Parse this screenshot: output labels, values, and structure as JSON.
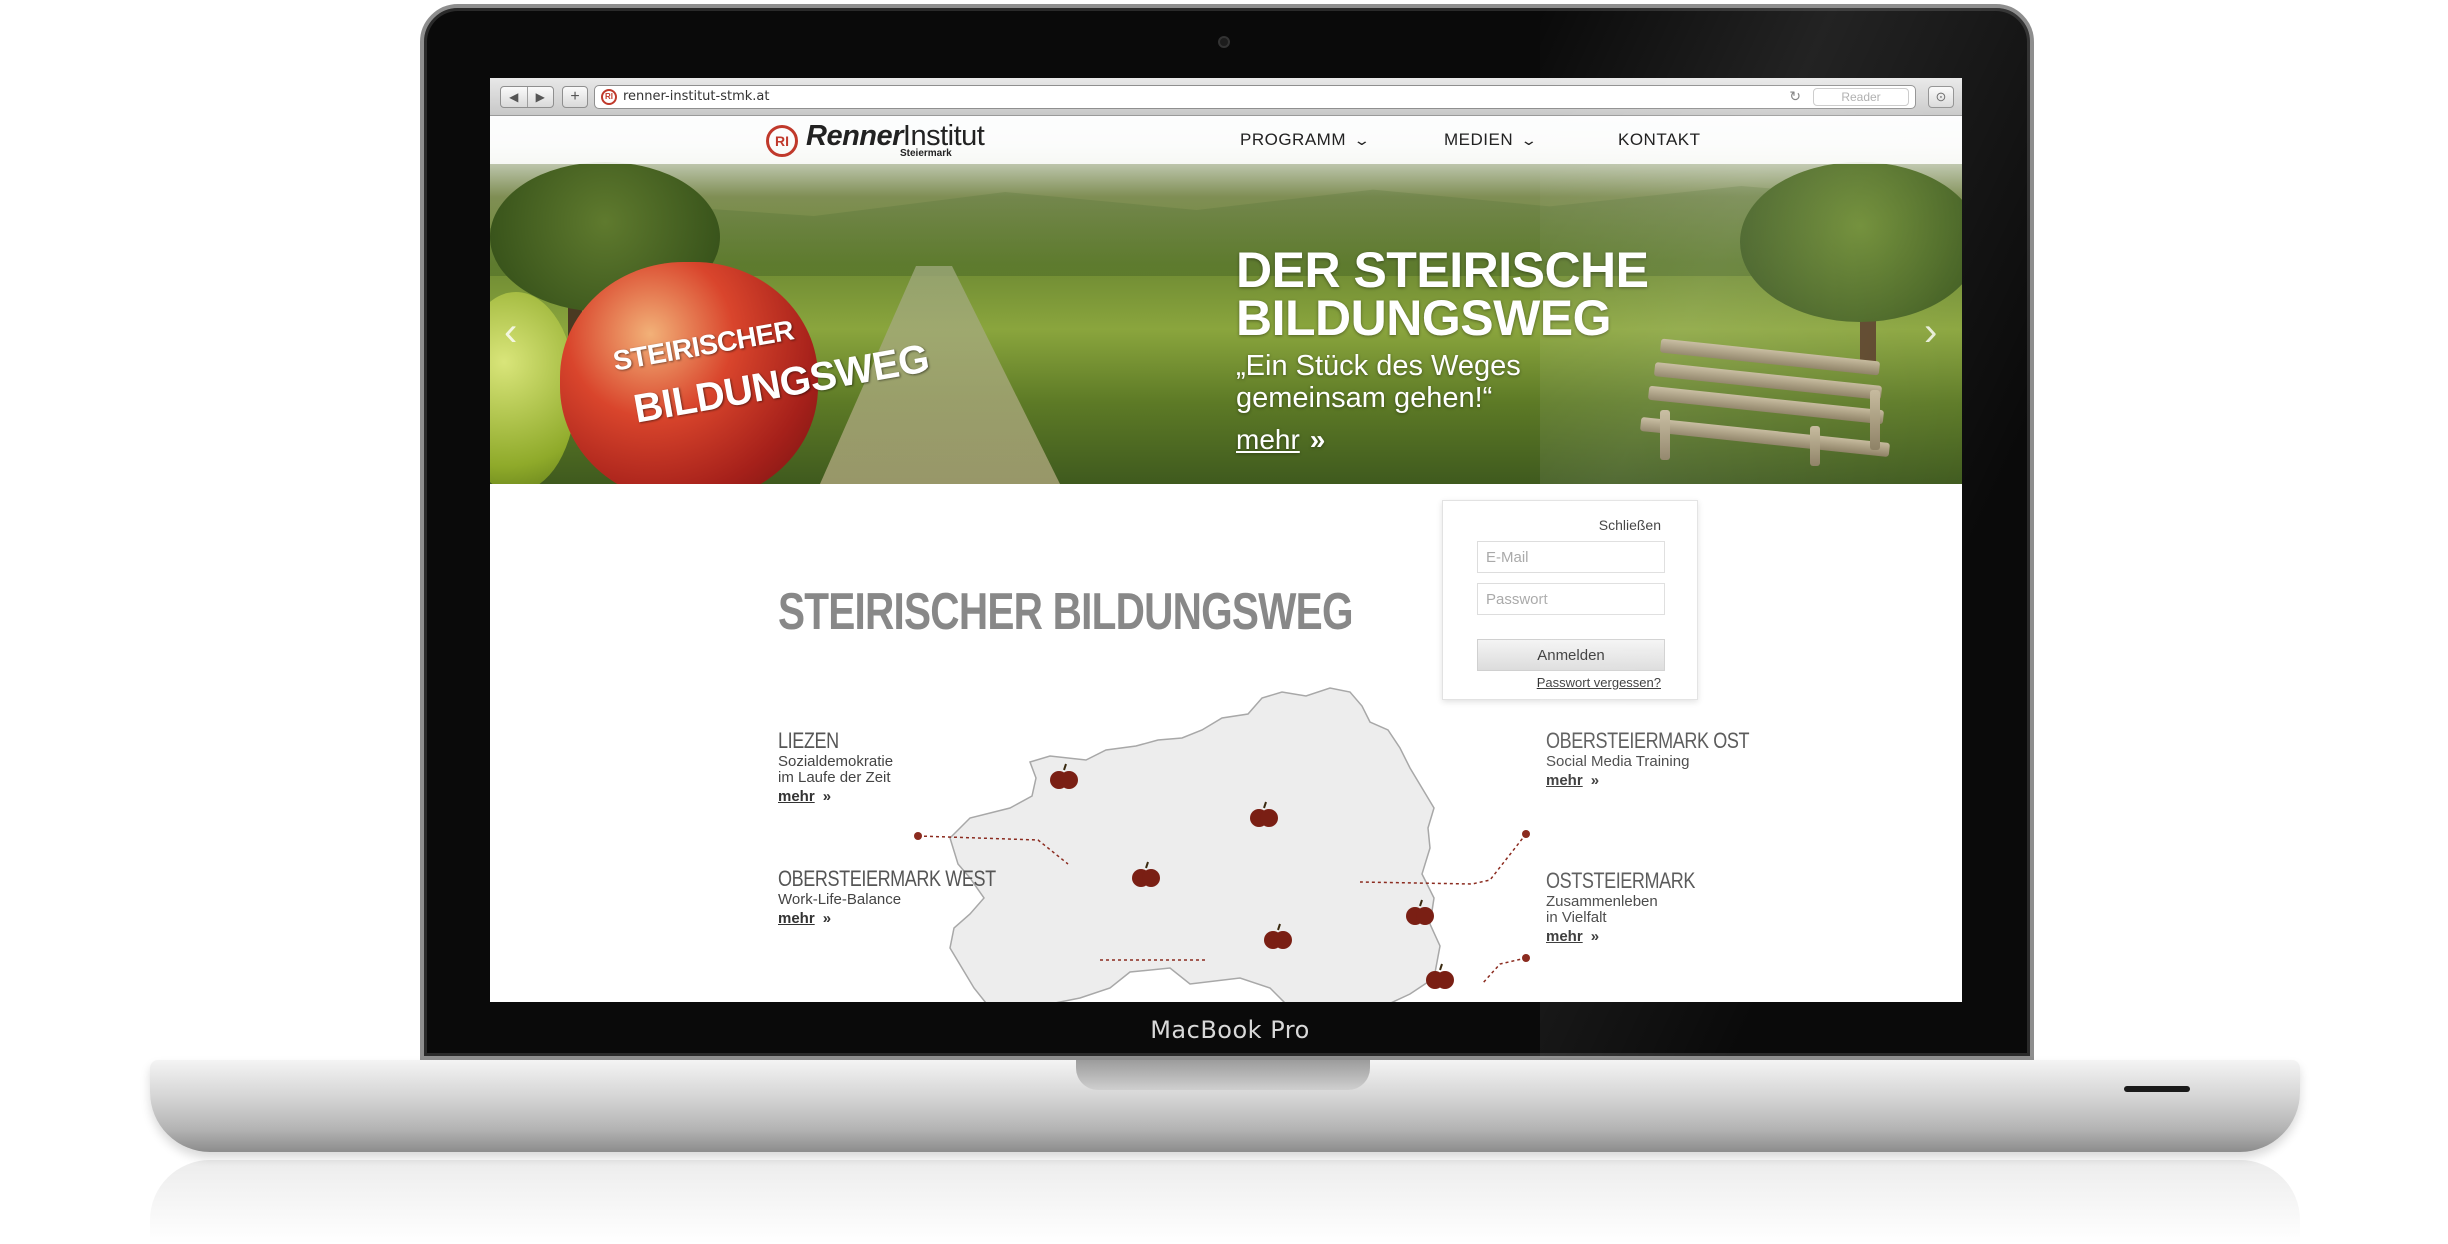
{
  "device": {
    "brand_label": "MacBook Pro"
  },
  "browser": {
    "url": "renner-institut-stmk.at",
    "back_icon": "◀",
    "forward_icon": "▶",
    "add_icon": "+",
    "reload_icon": "↻",
    "reader_label": "Reader",
    "download_icon": "⊙",
    "favicon_text": "RI"
  },
  "site": {
    "logo_mark": "RI",
    "logo_bold": "Renner",
    "logo_regular": "Institut",
    "logo_sub": "Steiermark",
    "nav": [
      {
        "label": "PROGRAMM",
        "has_dropdown": true
      },
      {
        "label": "MEDIEN",
        "has_dropdown": true
      },
      {
        "label": "KONTAKT",
        "has_dropdown": false
      }
    ],
    "chevron_icon": "⌄"
  },
  "hero": {
    "title_line1": "DER STEIRISCHE",
    "title_line2": "BILDUNGSWEG",
    "quote_line1": "„Ein Stück des Weges",
    "quote_line2": "gemeinsam gehen!“",
    "more_label": "mehr",
    "more_arrow": "»",
    "prev_arrow": "‹",
    "next_arrow": "›",
    "apple_text_line1": "STEIRISCHER",
    "apple_text_line2": "BILDUNGSWEG"
  },
  "section_title": "STEIRISCHER BILDUNGSWEG",
  "login": {
    "close_label": "Schließen",
    "email_placeholder": "E-Mail",
    "password_placeholder": "Passwort",
    "submit_label": "Anmelden",
    "forgot_label": "Passwort vergessen?"
  },
  "regions": [
    {
      "name": "LIEZEN",
      "desc": "Sozialdemokratie\nim Laufe der Zeit",
      "more": "mehr",
      "arrow": "»"
    },
    {
      "name": "OBERSTEIERMARK WEST",
      "desc": "Work-Life-Balance",
      "more": "mehr",
      "arrow": "»"
    },
    {
      "name": "OBERSTEIERMARK OST",
      "desc": "Social Media Training",
      "more": "mehr",
      "arrow": "»"
    },
    {
      "name": "OSTSTEIERMARK",
      "desc": "Zusammenleben\nin Vielfalt",
      "more": "mehr",
      "arrow": "»"
    }
  ],
  "colors": {
    "accent_red": "#c0392b",
    "map_fill": "#ededed",
    "map_stroke": "#a8a8a8",
    "connector": "#8b2b1f",
    "apple_marker": "#7a1f14"
  }
}
